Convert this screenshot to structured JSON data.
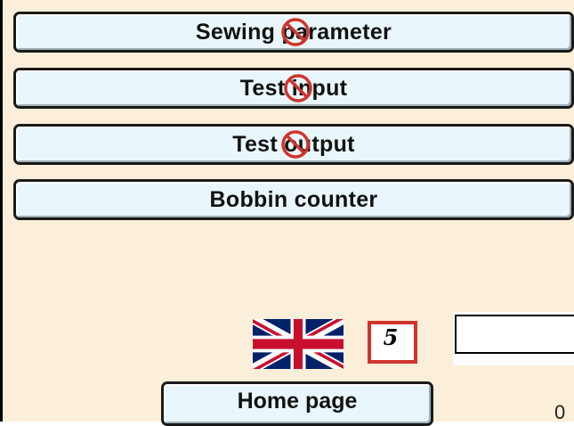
{
  "menu": {
    "items": [
      {
        "label": "Sewing parameter",
        "disabled": true
      },
      {
        "label": "Test input",
        "disabled": true
      },
      {
        "label": "Test output",
        "disabled": true
      },
      {
        "label": "Bobbin counter",
        "disabled": false
      }
    ]
  },
  "language": {
    "flag_icon": "uk-flag-icon",
    "code": "5"
  },
  "footer": {
    "home_label": "Home page",
    "counter_value": "0"
  },
  "colors": {
    "background": "#fcefd9",
    "button_fill": "#e9f7fc",
    "disabled_icon": "#d0342c",
    "lang_box_border": "#d0342c"
  }
}
